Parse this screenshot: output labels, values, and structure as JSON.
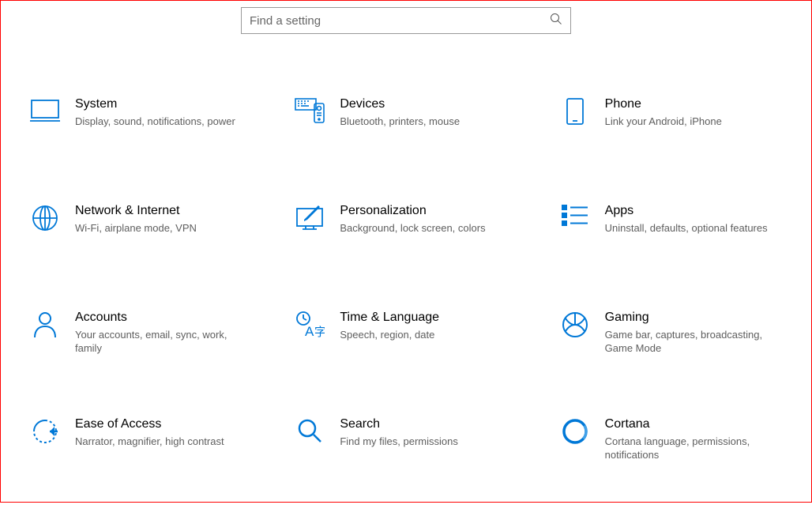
{
  "search": {
    "placeholder": "Find a setting"
  },
  "categories": [
    {
      "title": "System",
      "desc": "Display, sound, notifications, power",
      "icon": "system"
    },
    {
      "title": "Devices",
      "desc": "Bluetooth, printers, mouse",
      "icon": "devices"
    },
    {
      "title": "Phone",
      "desc": "Link your Android, iPhone",
      "icon": "phone"
    },
    {
      "title": "Network & Internet",
      "desc": "Wi-Fi, airplane mode, VPN",
      "icon": "network"
    },
    {
      "title": "Personalization",
      "desc": "Background, lock screen, colors",
      "icon": "personalization"
    },
    {
      "title": "Apps",
      "desc": "Uninstall, defaults, optional features",
      "icon": "apps"
    },
    {
      "title": "Accounts",
      "desc": "Your accounts, email, sync, work, family",
      "icon": "accounts"
    },
    {
      "title": "Time & Language",
      "desc": "Speech, region, date",
      "icon": "time-language"
    },
    {
      "title": "Gaming",
      "desc": "Game bar, captures, broadcasting, Game Mode",
      "icon": "gaming"
    },
    {
      "title": "Ease of Access",
      "desc": "Narrator, magnifier, high contrast",
      "icon": "ease-of-access"
    },
    {
      "title": "Search",
      "desc": "Find my files, permissions",
      "icon": "search"
    },
    {
      "title": "Cortana",
      "desc": "Cortana language, permissions, notifications",
      "icon": "cortana"
    }
  ],
  "colors": {
    "accent": "#0078d7"
  }
}
